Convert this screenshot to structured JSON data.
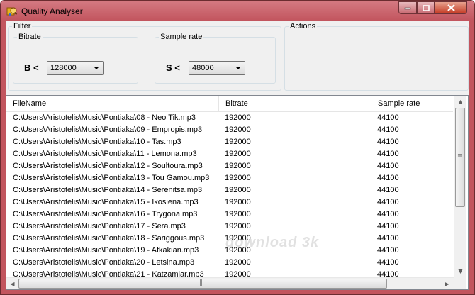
{
  "window": {
    "title": "Quality Analyser",
    "icon": "app-icon",
    "controls": {
      "minimize": "minimize-icon",
      "maximize": "maximize-icon",
      "close": "close-icon"
    }
  },
  "filter": {
    "label": "Filter",
    "bitrate": {
      "group_label": "Bitrate",
      "operator": "B <",
      "value": "128000"
    },
    "samplerate": {
      "group_label": "Sample rate",
      "operator": "S <",
      "value": "48000"
    }
  },
  "actions": {
    "label": "Actions"
  },
  "list": {
    "columns": [
      "FileName",
      "Bitrate",
      "Sample rate"
    ],
    "rows": [
      [
        "C:\\Users\\Aristotelis\\Music\\Pontiaka\\08 - Neo Tik.mp3",
        "192000",
        "44100"
      ],
      [
        "C:\\Users\\Aristotelis\\Music\\Pontiaka\\09 - Empropis.mp3",
        "192000",
        "44100"
      ],
      [
        "C:\\Users\\Aristotelis\\Music\\Pontiaka\\10 - Tas.mp3",
        "192000",
        "44100"
      ],
      [
        "C:\\Users\\Aristotelis\\Music\\Pontiaka\\11 - Lemona.mp3",
        "192000",
        "44100"
      ],
      [
        "C:\\Users\\Aristotelis\\Music\\Pontiaka\\12 - Soultoura.mp3",
        "192000",
        "44100"
      ],
      [
        "C:\\Users\\Aristotelis\\Music\\Pontiaka\\13 - Tou Gamou.mp3",
        "192000",
        "44100"
      ],
      [
        "C:\\Users\\Aristotelis\\Music\\Pontiaka\\14 - Serenitsa.mp3",
        "192000",
        "44100"
      ],
      [
        "C:\\Users\\Aristotelis\\Music\\Pontiaka\\15 - Ikosiena.mp3",
        "192000",
        "44100"
      ],
      [
        "C:\\Users\\Aristotelis\\Music\\Pontiaka\\16 - Trygona.mp3",
        "192000",
        "44100"
      ],
      [
        "C:\\Users\\Aristotelis\\Music\\Pontiaka\\17 - Sera.mp3",
        "192000",
        "44100"
      ],
      [
        "C:\\Users\\Aristotelis\\Music\\Pontiaka\\18 - Sariggous.mp3",
        "192000",
        "44100"
      ],
      [
        "C:\\Users\\Aristotelis\\Music\\Pontiaka\\19 - Afkakian.mp3",
        "192000",
        "44100"
      ],
      [
        "C:\\Users\\Aristotelis\\Music\\Pontiaka\\20 - Letsina.mp3",
        "192000",
        "44100"
      ],
      [
        "C:\\Users\\Aristotelis\\Music\\Pontiaka\\21 - Katzamiar.mp3",
        "192000",
        "44100"
      ]
    ]
  },
  "watermark": "download 3k",
  "colors": {
    "titlebar": "#c2555e",
    "client_bg": "#f0f0f0",
    "close_button": "#c43b24"
  }
}
